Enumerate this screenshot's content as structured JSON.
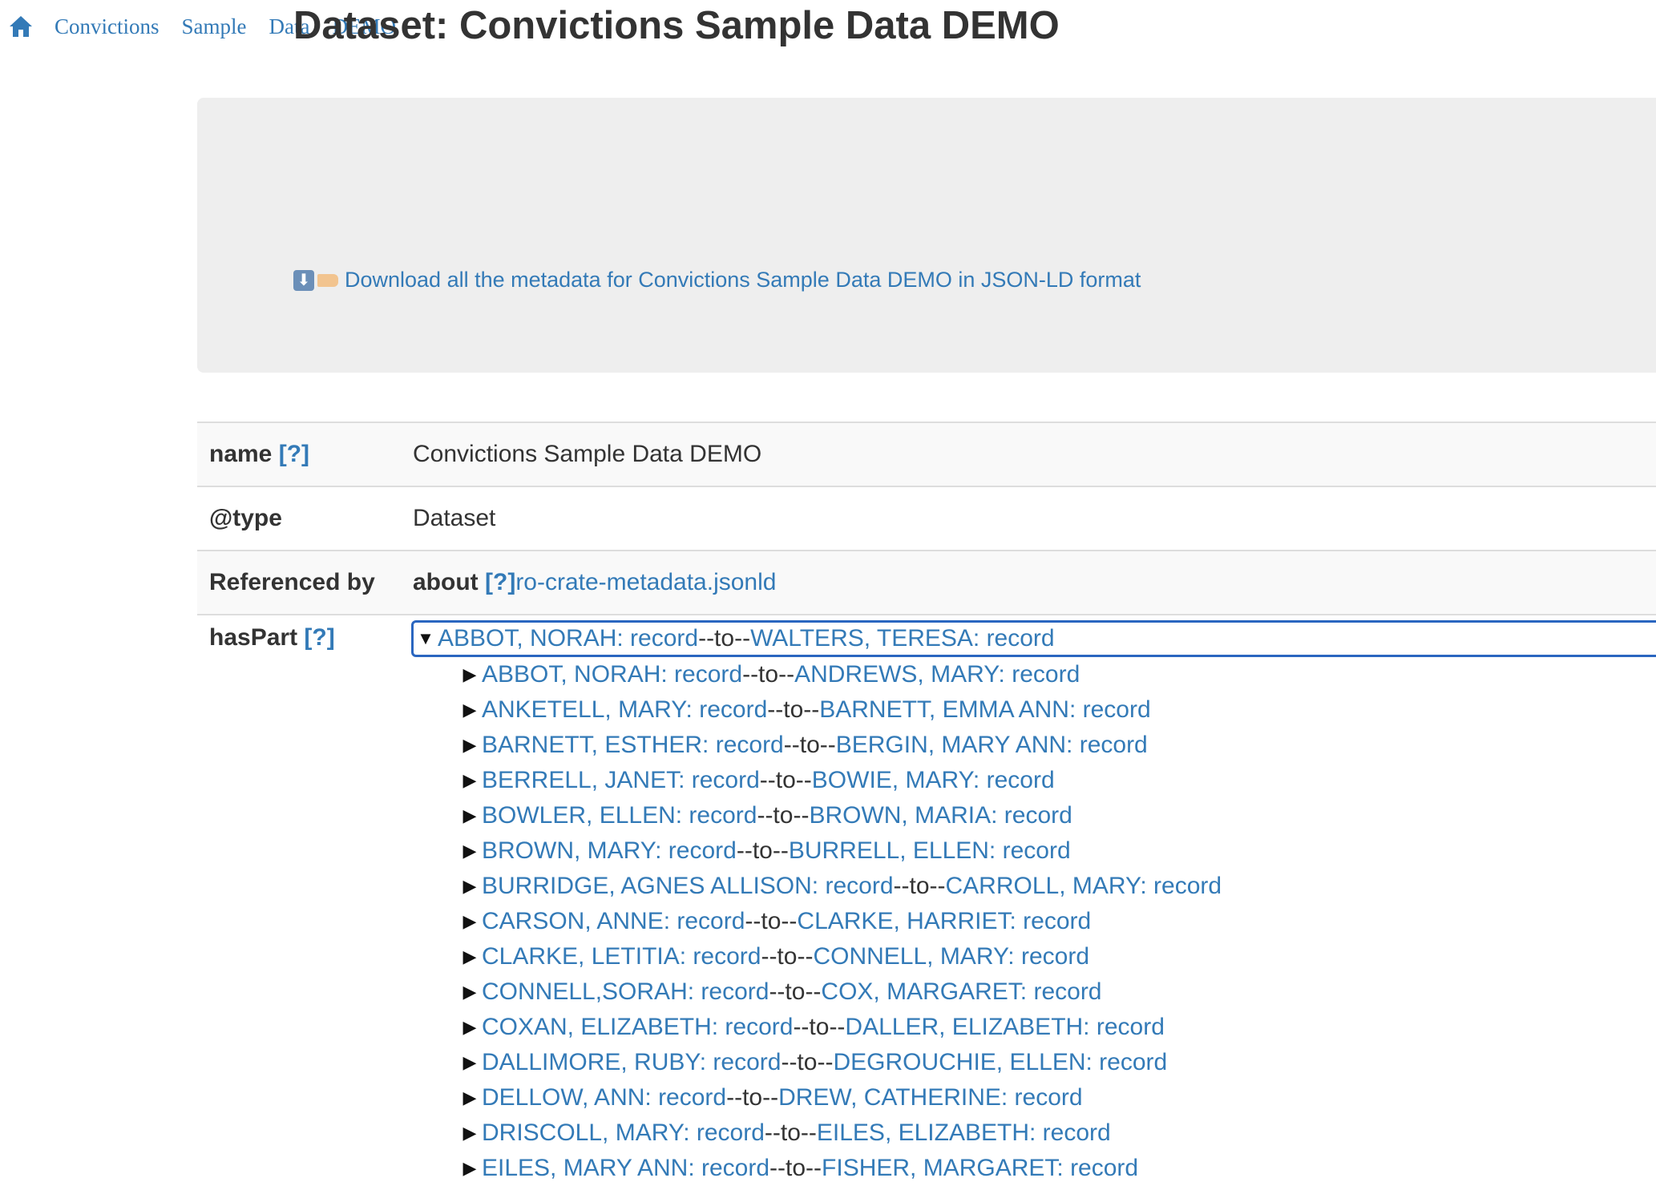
{
  "breadcrumb": {
    "items": [
      "Convictions",
      "Sample",
      "Data",
      "DEMO"
    ]
  },
  "header": {
    "title": "Dataset: Convictions Sample Data DEMO",
    "download_label": "Download all the metadata for Convictions Sample Data DEMO in JSON-LD format"
  },
  "properties": {
    "name_key": "name",
    "name_value": "Convictions Sample Data DEMO",
    "type_key": "@type",
    "type_value": "Dataset",
    "referenced_key": "Referenced by",
    "referenced_prefix": "about",
    "referenced_link": "ro-crate-metadata.jsonld",
    "haspart_key": "hasPart",
    "help_label": "[?]"
  },
  "tree": {
    "separator": "--to--",
    "root": {
      "from": "ABBOT, NORAH: record",
      "to": "WALTERS, TERESA: record"
    },
    "children": [
      {
        "from": "ABBOT, NORAH: record",
        "to": "ANDREWS, MARY: record"
      },
      {
        "from": "ANKETELL, MARY: record",
        "to": "BARNETT, EMMA ANN: record"
      },
      {
        "from": "BARNETT, ESTHER: record",
        "to": "BERGIN, MARY ANN: record"
      },
      {
        "from": "BERRELL, JANET: record",
        "to": "BOWIE, MARY: record"
      },
      {
        "from": "BOWLER, ELLEN: record",
        "to": "BROWN, MARIA: record"
      },
      {
        "from": "BROWN, MARY: record",
        "to": "BURRELL, ELLEN: record"
      },
      {
        "from": "BURRIDGE, AGNES ALLISON: record",
        "to": "CARROLL, MARY: record"
      },
      {
        "from": "CARSON, ANNE: record",
        "to": "CLARKE, HARRIET: record"
      },
      {
        "from": "CLARKE, LETITIA: record",
        "to": "CONNELL, MARY: record"
      },
      {
        "from": "CONNELL,SORAH: record",
        "to": "COX, MARGARET: record"
      },
      {
        "from": "COXAN, ELIZABETH: record",
        "to": "DALLER, ELIZABETH: record"
      },
      {
        "from": "DALLIMORE, RUBY: record",
        "to": "DEGROUCHIE, ELLEN: record"
      },
      {
        "from": "DELLOW, ANN: record",
        "to": "DREW, CATHERINE: record"
      },
      {
        "from": "DRISCOLL, MARY: record",
        "to": "EILES, ELIZABETH: record"
      },
      {
        "from": "EILES, MARY ANN: record",
        "to": "FISHER, MARGARET: record"
      }
    ]
  },
  "colors": {
    "link": "#337ab7",
    "jumbotron_bg": "#eeeeee",
    "focus_border": "#2a66c0"
  }
}
